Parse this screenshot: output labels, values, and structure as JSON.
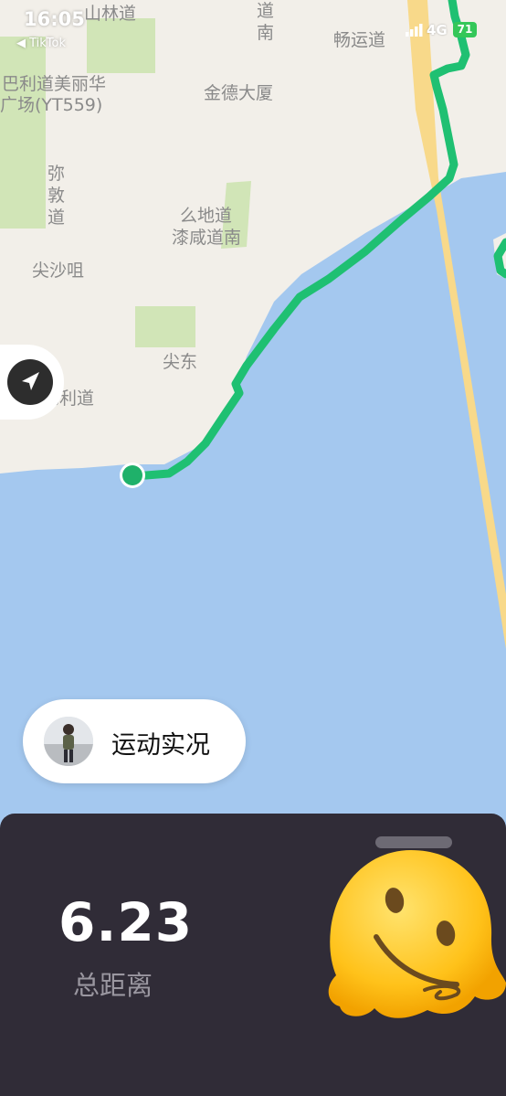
{
  "status_bar": {
    "time": "16:05",
    "back_app": "◀ TikTok",
    "network": "4G",
    "battery": "71"
  },
  "map": {
    "labels": {
      "shanlin": "山林道",
      "barry_mall": "巴利道美丽华",
      "barry_mall_2": "广场(YT559)",
      "kimtak": "金德大厦",
      "chongwan": "畅运道",
      "road_vertical_top": "道南",
      "mody_road": "么地道",
      "tsim_east_road": "漆咸道南",
      "mi_dun": "弥敦道",
      "tsim_sha_tsui": "尖沙咀",
      "tsim_dong": "尖东",
      "salisbury": "梳士巴利道"
    },
    "colors": {
      "land": "#f2efe9",
      "water": "#a4c8ef",
      "park": "#c5e1a5",
      "road": "#f8d98a",
      "route": "#1fc072"
    }
  },
  "locate_button": {
    "icon": "navigation-arrow-icon"
  },
  "live_status": {
    "label": "运动实况"
  },
  "stats": {
    "distance_value": "6.23",
    "distance_label": "总距离"
  },
  "sticker": {
    "icon": "melting-face-emoji"
  }
}
